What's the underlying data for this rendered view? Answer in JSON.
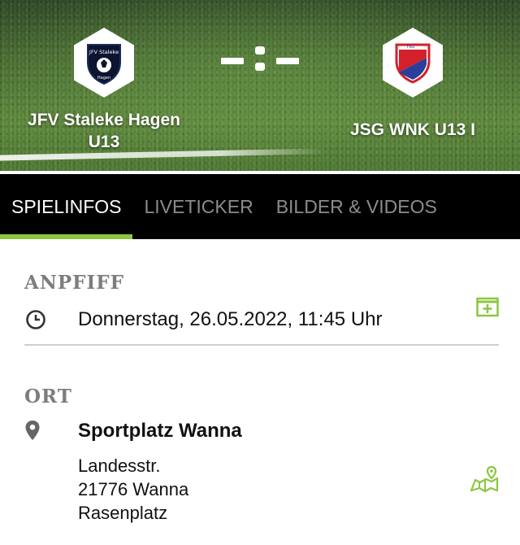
{
  "match": {
    "home_team": "JFV Staleke Hagen U13",
    "away_team": "JSG WNK U13 I",
    "home_logo_text": "JFV Staleke",
    "home_logo_subtext": "Hagen",
    "away_logo_text": "TSG",
    "score_display": "-:-"
  },
  "tabs": [
    {
      "label": "SPIELINFOS",
      "active": true
    },
    {
      "label": "LIVETICKER",
      "active": false
    },
    {
      "label": "BILDER & VIDEOS",
      "active": false
    }
  ],
  "kickoff": {
    "title": "ANPFIFF",
    "datetime": "Donnerstag, 26.05.2022, 11:45 Uhr"
  },
  "location": {
    "title": "ORT",
    "name": "Sportplatz Wanna",
    "street": "Landesstr.",
    "city": "21776 Wanna",
    "surface": "Rasenplatz"
  },
  "colors": {
    "accent": "#8cc63f",
    "tabbar": "#000000",
    "muted": "#7d7d7d"
  },
  "icons": [
    "clock-icon",
    "calendar-add-icon",
    "location-pin-icon",
    "map-icon"
  ]
}
